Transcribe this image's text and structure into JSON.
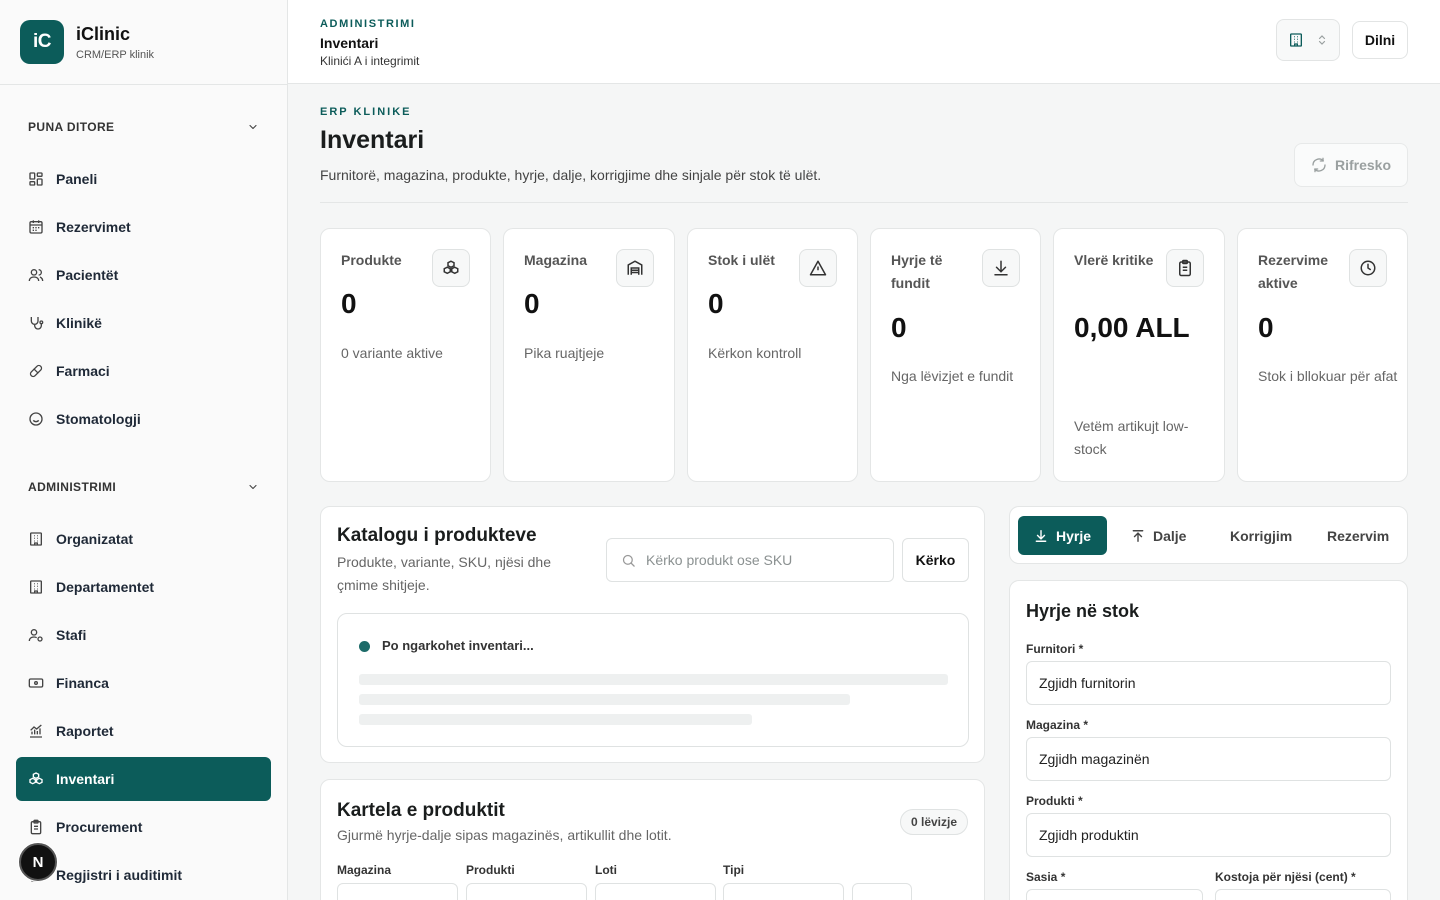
{
  "brand": {
    "logo": "iC",
    "name": "iClinic",
    "tagline": "CRM/ERP klinik"
  },
  "sidebar": {
    "groups": [
      {
        "label": "PUNA DITORE",
        "icon": "chevron-down-icon"
      },
      {
        "label": "ADMINISTRIMI",
        "icon": "chevron-down-icon"
      }
    ],
    "items": [
      {
        "label": "Paneli",
        "icon": "dashboard-grid-icon"
      },
      {
        "label": "Rezervimet",
        "icon": "calendar-icon"
      },
      {
        "label": "Pacientët",
        "icon": "users-icon"
      },
      {
        "label": "Klinikë",
        "icon": "stethoscope-icon"
      },
      {
        "label": "Farmaci",
        "icon": "pill-icon"
      },
      {
        "label": "Stomatologji",
        "icon": "smile-icon"
      },
      {
        "label": "Organizatat",
        "icon": "building-icon"
      },
      {
        "label": "Departamentet",
        "icon": "building-icon"
      },
      {
        "label": "Stafi",
        "icon": "user-gear-icon"
      },
      {
        "label": "Financa",
        "icon": "banknote-icon"
      },
      {
        "label": "Raportet",
        "icon": "chart-icon"
      },
      {
        "label": "Inventari",
        "icon": "boxes-icon",
        "active": true
      },
      {
        "label": "Procurement",
        "icon": "clipboard-icon"
      },
      {
        "label": "Regjistri i auditimit",
        "icon": "file-icon"
      }
    ],
    "avatar": "N"
  },
  "header": {
    "section": "ADMINISTRIMI",
    "title": "Inventari",
    "subtitle": "Klinići A i integrimit",
    "org_icon": "building-icon",
    "exit_label": "Dilni"
  },
  "page": {
    "eyebrow": "ERP KLINIKE",
    "title": "Inventari",
    "description": "Furnitorë, magazina, produkte, hyrje, dalje, korrigjime dhe sinjale për stok të ulët.",
    "refresh_label": "Rifresko"
  },
  "stats": [
    {
      "label": "Produkte",
      "value": "0",
      "note": "0 variante aktive",
      "icon": "boxes-icon"
    },
    {
      "label": "Magazina",
      "value": "0",
      "note": "Pika ruajtjeje",
      "icon": "warehouse-icon"
    },
    {
      "label": "Stok i ulët",
      "value": "0",
      "note": "Kërkon kontroll",
      "icon": "alert-triangle-icon"
    },
    {
      "label": "Hyrje të fundit",
      "value": "0",
      "note": "Nga lëvizjet e fundit",
      "icon": "download-icon"
    },
    {
      "label": "Vlerë kritike",
      "value": "0,00 ALL",
      "note": "Vetëm artikujt low-stock",
      "icon": "clipboard-icon"
    },
    {
      "label": "Rezervime aktive",
      "value": "0",
      "note": "Stok i bllokuar për afat",
      "icon": "clock-icon"
    }
  ],
  "catalog": {
    "title": "Katalogu i produkteve",
    "description": "Produkte, variante, SKU, njësi dhe çmime shitjeje.",
    "search_placeholder": "Kërko produkt ose SKU",
    "search_button": "Kërko",
    "loading_text": "Po ngarkohet inventari..."
  },
  "kartela": {
    "title": "Kartela e produktit",
    "description": "Gjurmë hyrje-dalje sipas magazinës, artikullit dhe lotit.",
    "badge": "0 lëvizje",
    "filters": [
      "Magazina",
      "Produkti",
      "Loti",
      "Tipi"
    ]
  },
  "tabs": [
    {
      "label": "Hyrje",
      "icon": "download-icon",
      "active": true
    },
    {
      "label": "Dalje",
      "icon": "upload-icon"
    },
    {
      "label": "Korrigjim"
    },
    {
      "label": "Rezervim"
    }
  ],
  "form": {
    "title": "Hyrje në stok",
    "fields": [
      {
        "label": "Furnitori *",
        "value": "Zgjidh furnitorin"
      },
      {
        "label": "Magazina *",
        "value": "Zgjidh magazinën"
      },
      {
        "label": "Produkti *",
        "value": "Zgjidh produktin"
      },
      {
        "label": "Sasia *",
        "value": ""
      },
      {
        "label": "Kostoja për njësi (cent) *",
        "value": ""
      }
    ]
  },
  "colors": {
    "accent": "#0c5c5a",
    "background": "#f5f6f6",
    "surface": "#ffffff",
    "border": "#e4e6e6"
  }
}
